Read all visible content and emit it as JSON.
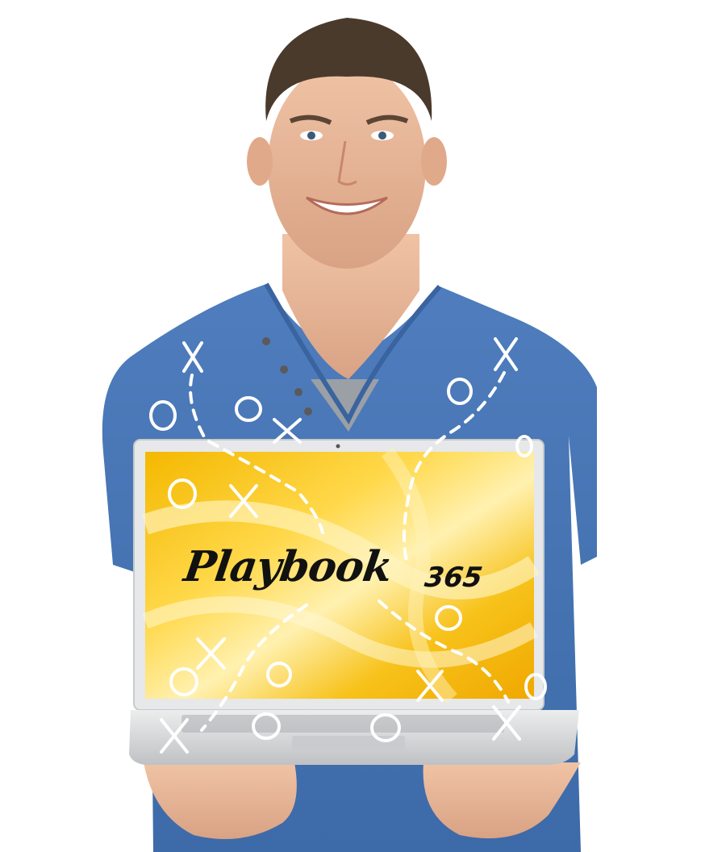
{
  "photo": {
    "subject": "smiling-man-holding-laptop",
    "colors": {
      "background": "#ffffff",
      "shirt": "#4a78b6",
      "skin": "#e8b99a",
      "hair": "#4a3a2c",
      "screen_gold": "#f2b400",
      "laptop_silver": "#d8d9db"
    }
  },
  "screen": {
    "logo_text": "Playbook",
    "logo_number": "365"
  },
  "overlay": {
    "icons": [
      "x-mark-icon",
      "o-mark-icon",
      "dashed-route-icon"
    ]
  }
}
